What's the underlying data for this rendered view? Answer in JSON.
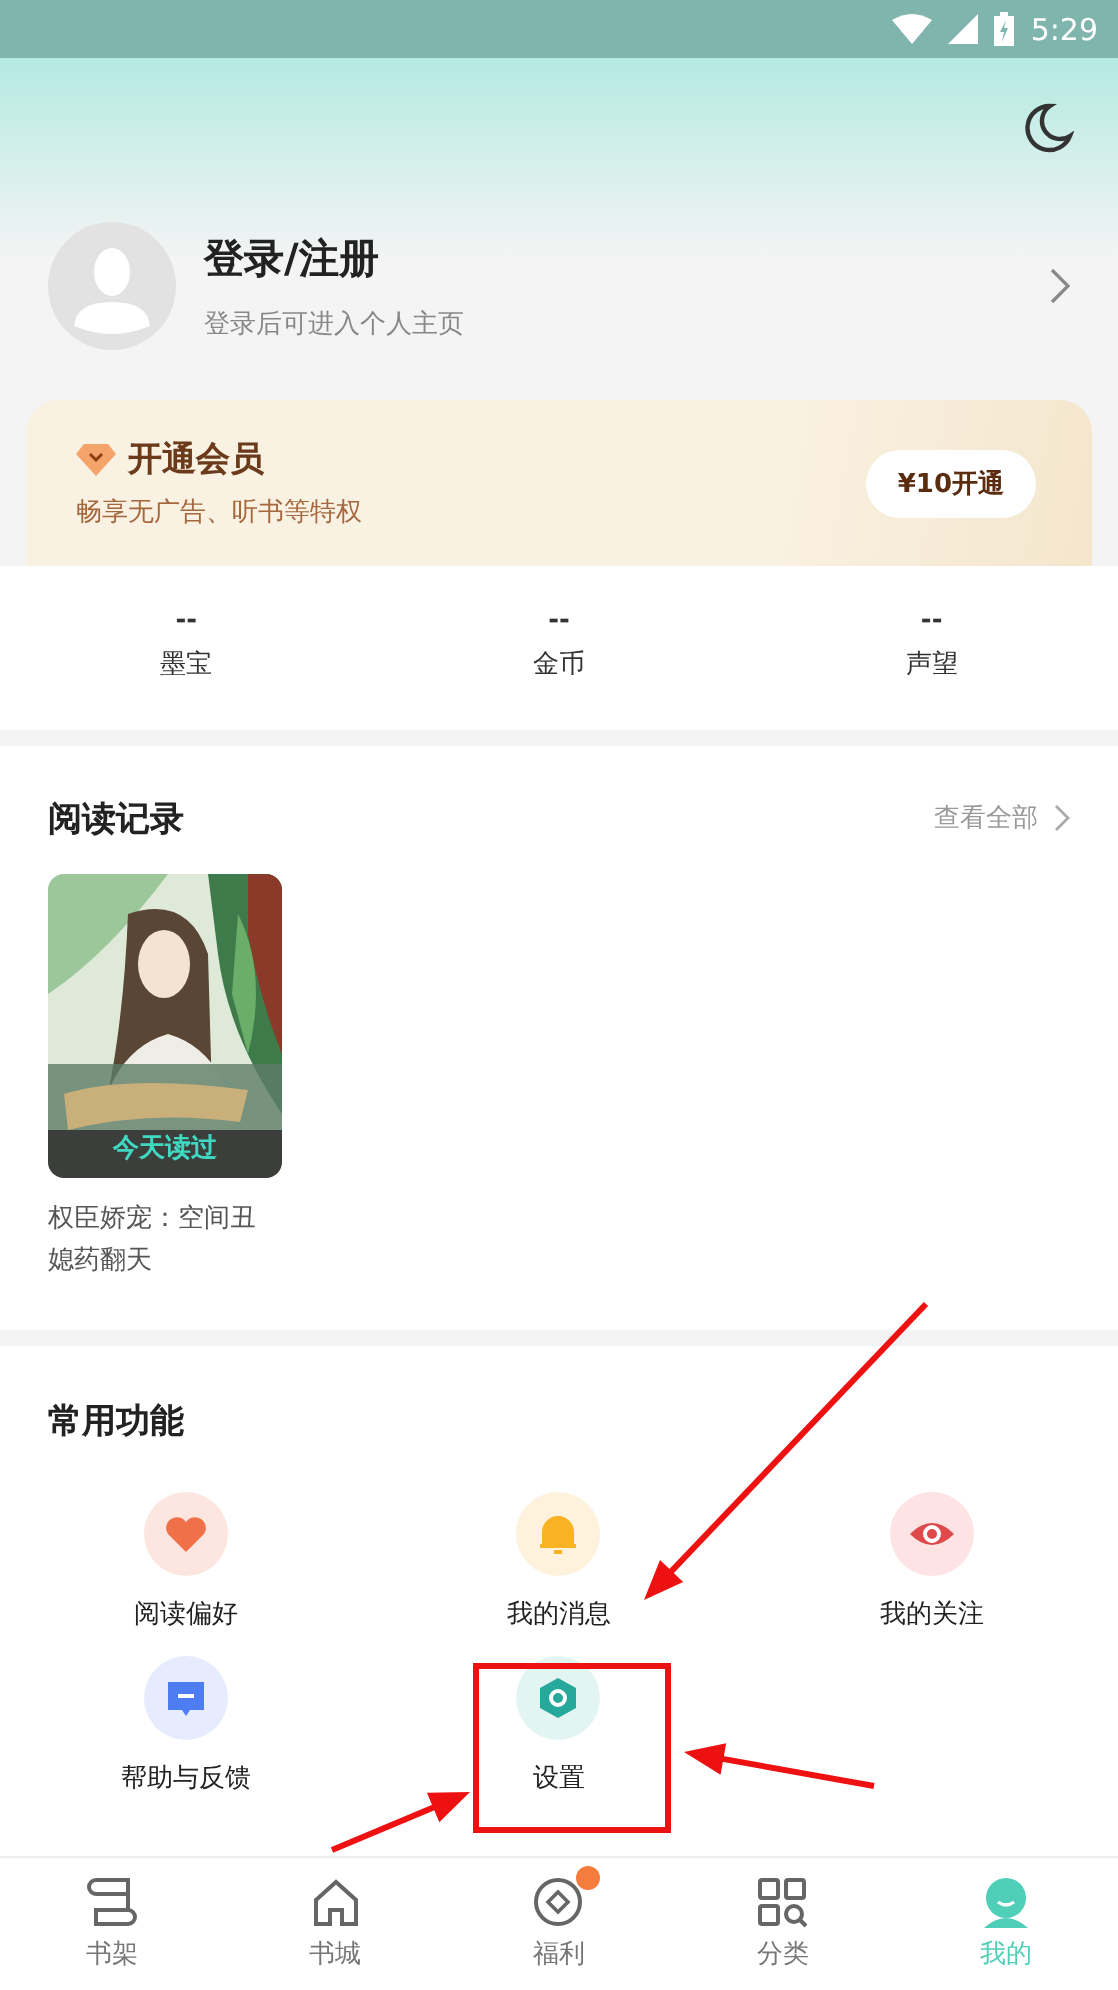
{
  "status_bar": {
    "time": "5:29"
  },
  "profile": {
    "title": "登录/注册",
    "subtitle": "登录后可进入个人主页"
  },
  "vip": {
    "title": "开通会员",
    "subtitle": "畅享无广告、听书等特权",
    "button": "¥10开通"
  },
  "stats": [
    {
      "value": "--",
      "label": "墨宝"
    },
    {
      "value": "--",
      "label": "金币"
    },
    {
      "value": "--",
      "label": "声望"
    }
  ],
  "reading_history": {
    "title": "阅读记录",
    "more": "查看全部",
    "books": [
      {
        "badge": "今天读过",
        "title": "权臣娇宠：空间丑媳药翻天"
      }
    ]
  },
  "functions": {
    "title": "常用功能",
    "items": [
      {
        "kind": "heart",
        "label": "阅读偏好"
      },
      {
        "kind": "bell",
        "label": "我的消息"
      },
      {
        "kind": "eye",
        "label": "我的关注"
      },
      {
        "kind": "chat",
        "label": "帮助与反馈"
      },
      {
        "kind": "gear",
        "label": "设置"
      }
    ]
  },
  "tabs": [
    {
      "kind": "shelf",
      "label": "书架",
      "selected": false
    },
    {
      "kind": "store",
      "label": "书城",
      "selected": false
    },
    {
      "kind": "welfare",
      "label": "福利",
      "selected": false
    },
    {
      "kind": "category",
      "label": "分类",
      "selected": false
    },
    {
      "kind": "me",
      "label": "我的",
      "selected": true
    }
  ]
}
